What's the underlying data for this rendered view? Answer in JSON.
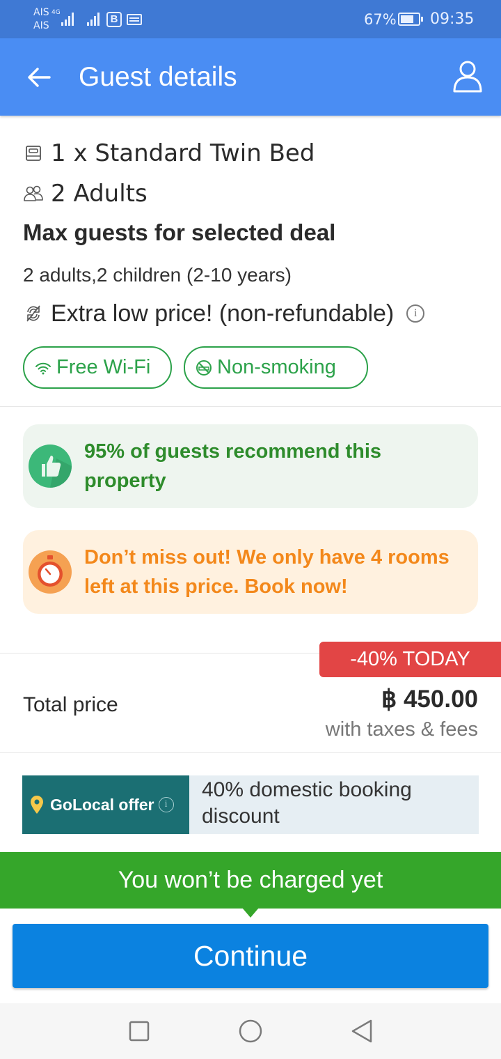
{
  "status_bar": {
    "carrier_top": "AIS",
    "net_type": "4G",
    "carrier_bottom": "AIS",
    "badge": "B",
    "battery_pct": "67%",
    "time": "09:35"
  },
  "header": {
    "title": "Guest details"
  },
  "room": {
    "type": "1 x Standard Twin Bed",
    "occupancy": "2 Adults",
    "max_heading": "Max guests for selected deal",
    "max_detail": "2 adults,2 children (2-10 years)",
    "price_type": "Extra low price! (non-refundable)"
  },
  "amenities": [
    {
      "label": "Free Wi-Fi"
    },
    {
      "label": "Non-smoking"
    }
  ],
  "banners": {
    "recommend": "95% of guests recommend this property",
    "scarcity": "Don’t miss out! We only have 4 rooms left at this price. Book now!"
  },
  "price": {
    "discount_badge": "-40% TODAY",
    "total_label": "Total price",
    "total_value": "฿ 450.00",
    "taxes_note": "with taxes & fees"
  },
  "golocal": {
    "label": "GoLocal offer",
    "description": "40% domestic booking discount"
  },
  "footer": {
    "charge_note": "You won’t be charged yet",
    "continue_label": "Continue"
  },
  "colors": {
    "app_bar": "#4a8df3",
    "status_bar": "#3f79d4",
    "green": "#35a62a",
    "discount_red": "#e24545",
    "scarcity_orange": "#f3881b",
    "golocal_teal": "#1b6f73",
    "continue_blue": "#0b82e0"
  }
}
